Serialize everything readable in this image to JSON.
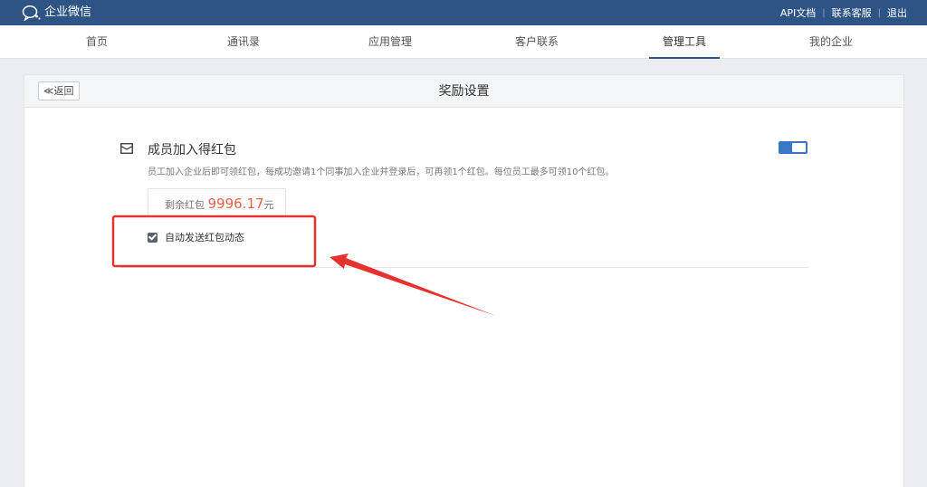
{
  "topbar": {
    "logo_text": "企业微信",
    "links": [
      "API文档",
      "联系客服",
      "退出"
    ]
  },
  "nav": {
    "items": [
      "首页",
      "通讯录",
      "应用管理",
      "客户联系",
      "管理工具",
      "我的企业"
    ],
    "active": "管理工具"
  },
  "page": {
    "back_label": "≪返回",
    "title": "奖励设置"
  },
  "setting": {
    "title": "成员加入得红包",
    "description": "员工加入企业后即可领红包，每成功邀请1个同事加入企业并登录后，可再领1个红包。每位员工最多可领10个红包。",
    "enabled": true,
    "remain_label": "剩余红包",
    "remain_amount": "9996.17",
    "remain_unit": "元",
    "auto_send_label": "自动发送红包动态",
    "auto_send_checked": true
  },
  "annotation": {
    "color": "#e5322d"
  }
}
